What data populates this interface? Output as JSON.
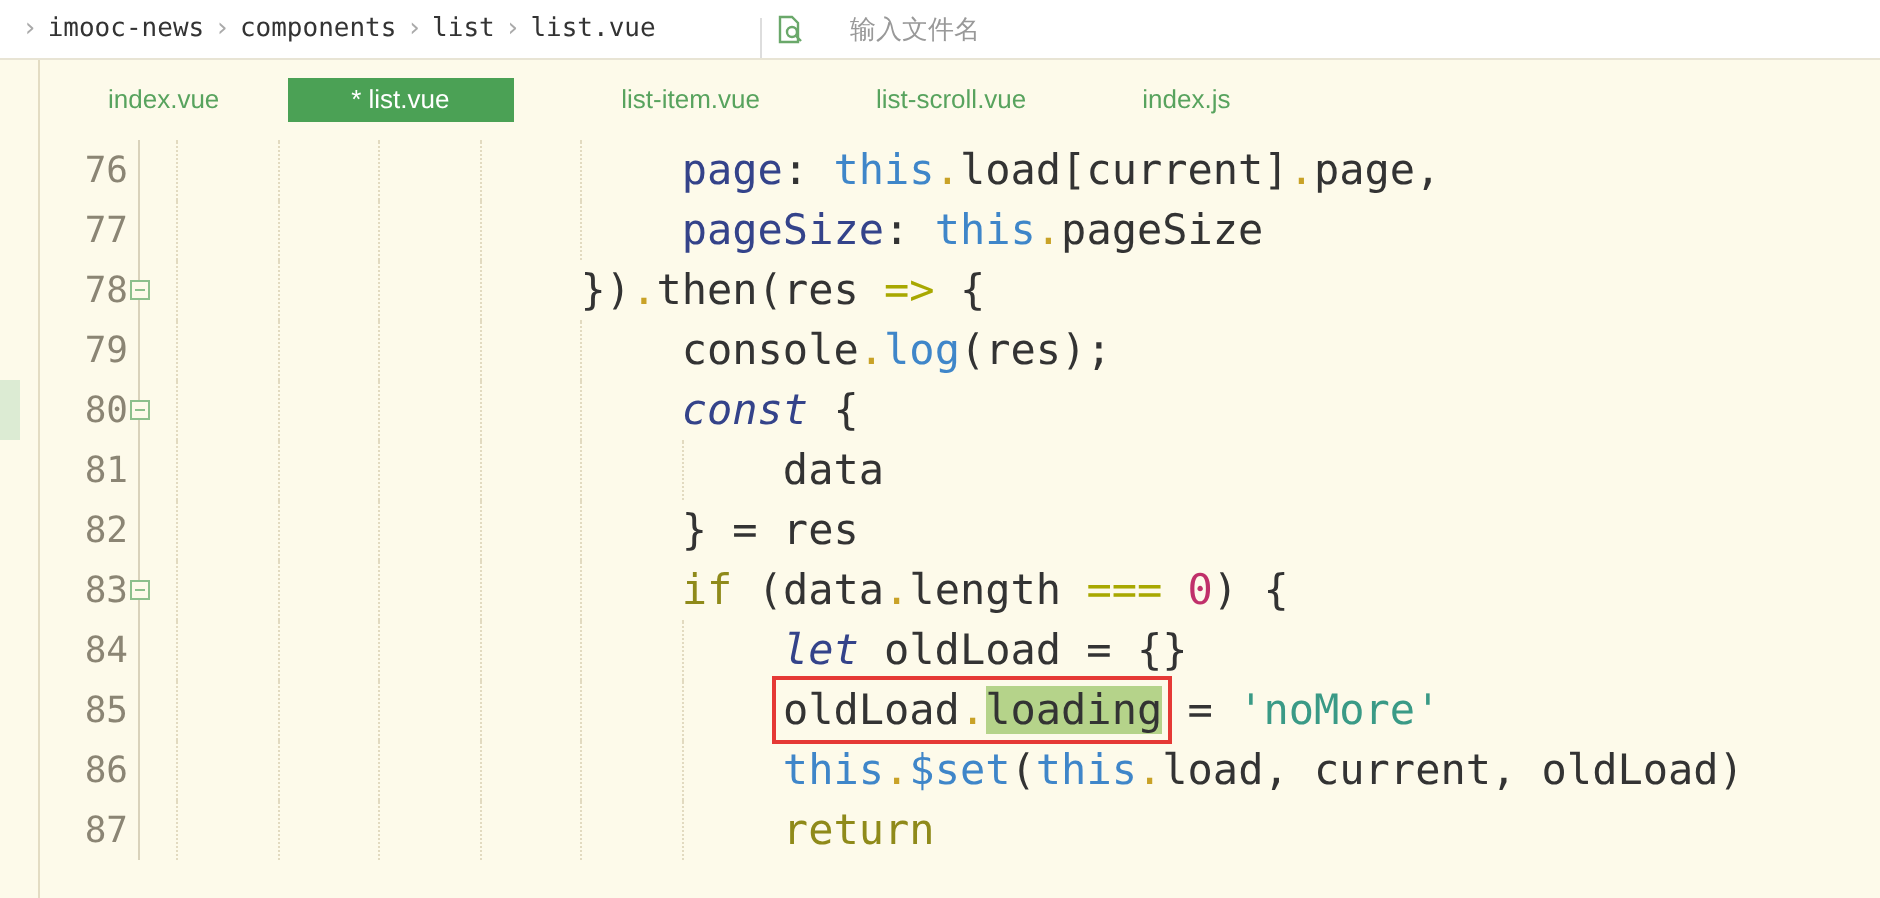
{
  "breadcrumb": [
    {
      "separator": "›",
      "label": "imooc-news"
    },
    {
      "separator": "›",
      "label": "components"
    },
    {
      "separator": "›",
      "label": "list"
    },
    {
      "separator": "›",
      "label": "list.vue"
    }
  ],
  "search": {
    "placeholder": "输入文件名"
  },
  "tabs": [
    {
      "label": "index.vue",
      "selected": false
    },
    {
      "label": "* list.vue",
      "selected": true
    },
    {
      "label": "list-item.vue",
      "selected": false
    },
    {
      "label": "list-scroll.vue",
      "selected": false
    },
    {
      "label": "index.js",
      "selected": false
    }
  ],
  "lines": [
    {
      "number": "76",
      "fold": false,
      "changed": false,
      "tokens": [
        {
          "t": "                    page",
          "kind": "prop"
        },
        {
          "t": ": ",
          "kind": "plain"
        },
        {
          "t": "this",
          "kind": "this"
        },
        {
          "t": ".",
          "kind": "dot"
        },
        {
          "t": "load[current]",
          "kind": "plain"
        },
        {
          "t": ".",
          "kind": "dot"
        },
        {
          "t": "page,",
          "kind": "plain"
        }
      ]
    },
    {
      "number": "77",
      "fold": false,
      "changed": false,
      "tokens": [
        {
          "t": "                    pageSize",
          "kind": "prop"
        },
        {
          "t": ": ",
          "kind": "plain"
        },
        {
          "t": "this",
          "kind": "this"
        },
        {
          "t": ".",
          "kind": "dot"
        },
        {
          "t": "pageSize",
          "kind": "plain"
        }
      ]
    },
    {
      "number": "78",
      "fold": true,
      "changed": false,
      "tokens": [
        {
          "t": "                })",
          "kind": "plain"
        },
        {
          "t": ".",
          "kind": "dot"
        },
        {
          "t": "then(res ",
          "kind": "plain"
        },
        {
          "t": "=>",
          "kind": "op"
        },
        {
          "t": " {",
          "kind": "plain"
        }
      ]
    },
    {
      "number": "79",
      "fold": false,
      "changed": false,
      "tokens": [
        {
          "t": "                    console",
          "kind": "plain"
        },
        {
          "t": ".",
          "kind": "dot"
        },
        {
          "t": "log",
          "kind": "func"
        },
        {
          "t": "(res);",
          "kind": "plain"
        }
      ]
    },
    {
      "number": "80",
      "fold": true,
      "changed": true,
      "tokens": [
        {
          "t": "                    const",
          "kind": "decl"
        },
        {
          "t": " {",
          "kind": "plain"
        }
      ]
    },
    {
      "number": "81",
      "fold": false,
      "changed": false,
      "tokens": [
        {
          "t": "                        data",
          "kind": "plain"
        }
      ]
    },
    {
      "number": "82",
      "fold": false,
      "changed": false,
      "tokens": [
        {
          "t": "                    } = res",
          "kind": "plain"
        }
      ]
    },
    {
      "number": "83",
      "fold": true,
      "changed": false,
      "tokens": [
        {
          "t": "                    if",
          "kind": "kw"
        },
        {
          "t": " (data",
          "kind": "plain"
        },
        {
          "t": ".",
          "kind": "dot"
        },
        {
          "t": "length ",
          "kind": "plain"
        },
        {
          "t": "===",
          "kind": "op"
        },
        {
          "t": " 0",
          "kind": "num"
        },
        {
          "t": ") {",
          "kind": "plain"
        }
      ]
    },
    {
      "number": "84",
      "fold": false,
      "changed": false,
      "tokens": [
        {
          "t": "                        let",
          "kind": "decl"
        },
        {
          "t": " oldLoad = {}",
          "kind": "plain"
        }
      ]
    },
    {
      "number": "85",
      "fold": false,
      "changed": false,
      "tokens": [
        {
          "kind": "box",
          "children": [
            {
              "t": "                        oldLoad",
              "kind": "plain"
            },
            {
              "t": ".",
              "kind": "dot"
            },
            {
              "t": "loading",
              "kind": "match"
            }
          ]
        },
        {
          "t": " = ",
          "kind": "plain"
        },
        {
          "t": "'noMore'",
          "kind": "str"
        }
      ]
    },
    {
      "number": "86",
      "fold": false,
      "changed": false,
      "tokens": [
        {
          "t": "                        this",
          "kind": "this"
        },
        {
          "t": ".",
          "kind": "dot"
        },
        {
          "t": "$set",
          "kind": "func"
        },
        {
          "t": "(",
          "kind": "plain"
        },
        {
          "t": "this",
          "kind": "this"
        },
        {
          "t": ".",
          "kind": "dot"
        },
        {
          "t": "load, current, oldLoad)",
          "kind": "plain"
        }
      ]
    },
    {
      "number": "87",
      "fold": false,
      "changed": false,
      "tokens": [
        {
          "t": "                        return",
          "kind": "kw"
        }
      ]
    }
  ]
}
